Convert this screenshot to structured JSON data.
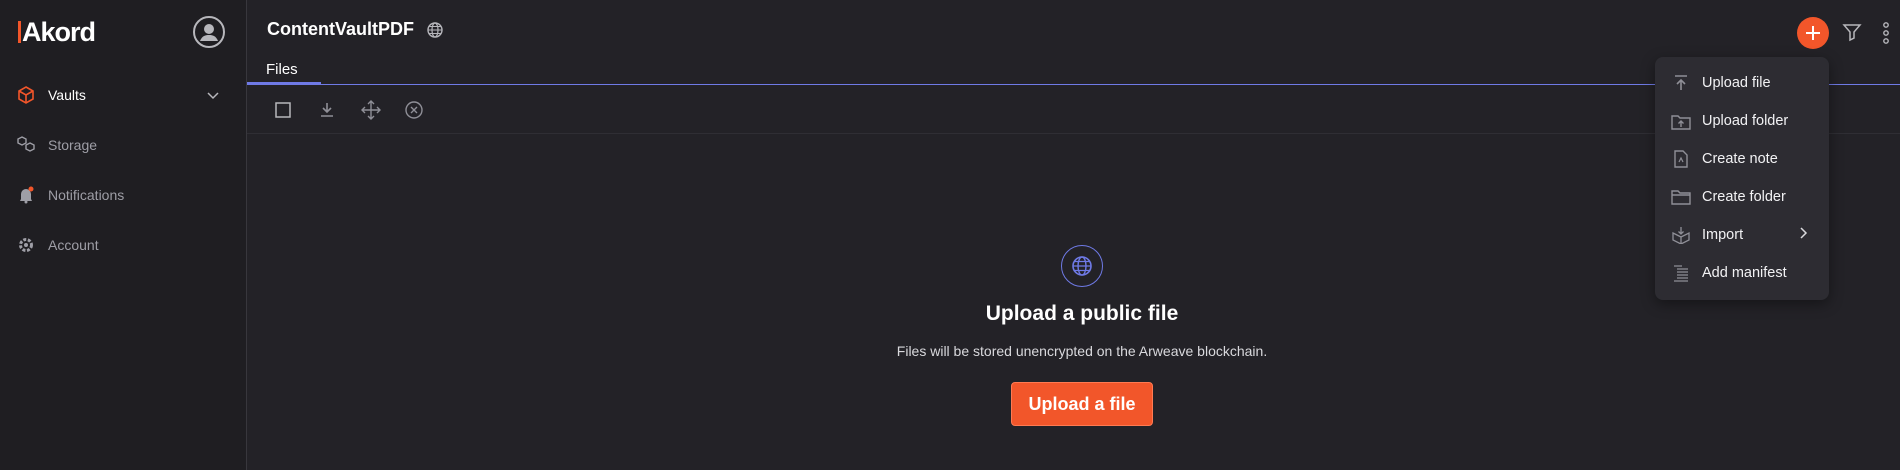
{
  "sidebar": {
    "logo": "Akord",
    "items": [
      {
        "label": "Vaults",
        "icon": "cube-icon"
      },
      {
        "label": "Storage",
        "icon": "storage-icon"
      },
      {
        "label": "Notifications",
        "icon": "bell-icon"
      },
      {
        "label": "Account",
        "icon": "gear-icon"
      }
    ]
  },
  "header": {
    "title": "ContentVaultPDF",
    "tabs": [
      {
        "label": "Files"
      }
    ]
  },
  "menu": {
    "items": [
      {
        "label": "Upload file",
        "icon": "upload-file-icon"
      },
      {
        "label": "Upload folder",
        "icon": "upload-folder-icon"
      },
      {
        "label": "Create note",
        "icon": "note-icon"
      },
      {
        "label": "Create folder",
        "icon": "folder-icon"
      },
      {
        "label": "Import",
        "icon": "import-icon"
      },
      {
        "label": "Add manifest",
        "icon": "manifest-icon"
      }
    ]
  },
  "empty_state": {
    "title": "Upload a public file",
    "description": "Files will be stored unencrypted on the Arweave blockchain.",
    "button": "Upload a file"
  },
  "colors": {
    "accent": "#f2562a",
    "link": "#6f7ae6",
    "background": "#232227"
  }
}
